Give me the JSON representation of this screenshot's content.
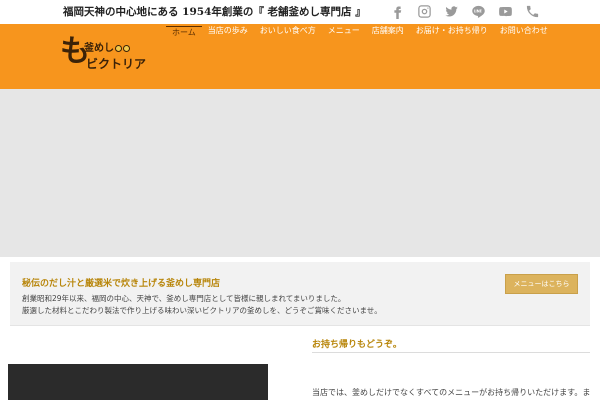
{
  "topbar": {
    "tagline": "福岡天神の中心地にある 1954年創業の『 老舗釜めし専門店 』",
    "social": [
      {
        "icon": "facebook-icon"
      },
      {
        "icon": "instagram-icon"
      },
      {
        "icon": "twitter-icon"
      },
      {
        "icon": "line-icon"
      },
      {
        "icon": "youtube-icon"
      },
      {
        "icon": "phone-icon"
      }
    ]
  },
  "header": {
    "logo": {
      "kanji": "も",
      "top_text": "釜めし",
      "bottom_text": "ビクトリア"
    },
    "nav": [
      {
        "label": "ホーム",
        "active": true
      },
      {
        "label": "当店の歩み"
      },
      {
        "label": "おいしい食べ方"
      },
      {
        "label": "メニュー"
      },
      {
        "label": "店舗案内"
      },
      {
        "label": "お届け・お持ち帰り"
      },
      {
        "label": "お問い合わせ"
      }
    ]
  },
  "intro": {
    "title": "秘伝のだし汁と厳選米で炊き上げる釜めし専門店",
    "line1": "創業昭和29年以来、福岡の中心、天神で、釜めし専門店として皆様に親しまれてまいりました。",
    "line2": "厳選した材料とこだわり製法で作り上げる味わい深いビクトリアの釜めしを、どうぞご賞味くださいませ。",
    "button_label": "メニューはこちら"
  },
  "takeout": {
    "title": "お持ち帰りもどうぞ。",
    "text": "当店では、釜めしだけでなくすべてのメニューがお持ち帰りいただけます。ま"
  },
  "colors": {
    "header_bg": "#f7951d",
    "accent_gold": "#b8860b",
    "button_bg": "#dcb35d"
  }
}
